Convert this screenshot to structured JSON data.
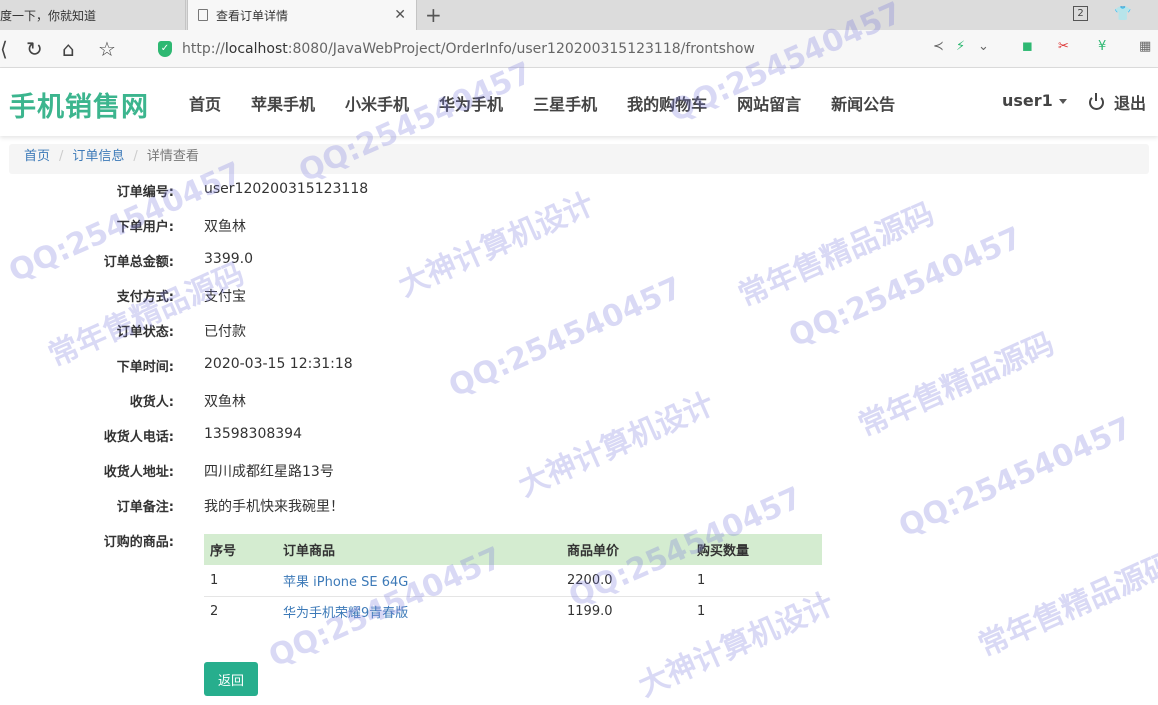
{
  "browser": {
    "tabs": [
      {
        "title": "度一下，你就知道"
      },
      {
        "title": "查看订单详情"
      }
    ],
    "window_count": "2",
    "url_prefix": "http://",
    "url_host": "localhost",
    "url_path": ":8080/JavaWebProject/OrderInfo/user120200315123118/frontshow"
  },
  "site": {
    "logo": "手机销售网",
    "menu": [
      "首页",
      "苹果手机",
      "小米手机",
      "华为手机",
      "三星手机",
      "我的购物车",
      "网站留言",
      "新闻公告"
    ],
    "user": "user1",
    "logout": "退出"
  },
  "breadcrumb": [
    "首页",
    "订单信息",
    "详情查看"
  ],
  "order": [
    {
      "label": "订单编号:",
      "value": "user120200315123118"
    },
    {
      "label": "下单用户:",
      "value": "双鱼林"
    },
    {
      "label": "订单总金额:",
      "value": "3399.0"
    },
    {
      "label": "支付方式:",
      "value": "支付宝"
    },
    {
      "label": "订单状态:",
      "value": "已付款"
    },
    {
      "label": "下单时间:",
      "value": "2020-03-15 12:31:18"
    },
    {
      "label": "收货人:",
      "value": "双鱼林"
    },
    {
      "label": "收货人电话:",
      "value": "13598308394"
    },
    {
      "label": "收货人地址:",
      "value": "四川成都红星路13号"
    },
    {
      "label": "订单备注:",
      "value": "我的手机快来我碗里！"
    }
  ],
  "items_label": "订购的商品:",
  "items_table": {
    "headers": [
      "序号",
      "订单商品",
      "商品单价",
      "购买数量"
    ],
    "rows": [
      [
        "1",
        "苹果 iPhone SE 64G",
        "2200.0",
        "1"
      ],
      [
        "2",
        "华为手机荣耀9青春版",
        "1199.0",
        "1"
      ]
    ]
  },
  "back_button": "返回",
  "watermarks": [
    "QQ:254540457",
    "常年售精品源码",
    "大神计算机设计"
  ],
  "colors": {
    "brand": "#3cb58e",
    "button": "#27ae8d",
    "table_header": "#d4ecd0",
    "link": "#3d7ab8"
  }
}
